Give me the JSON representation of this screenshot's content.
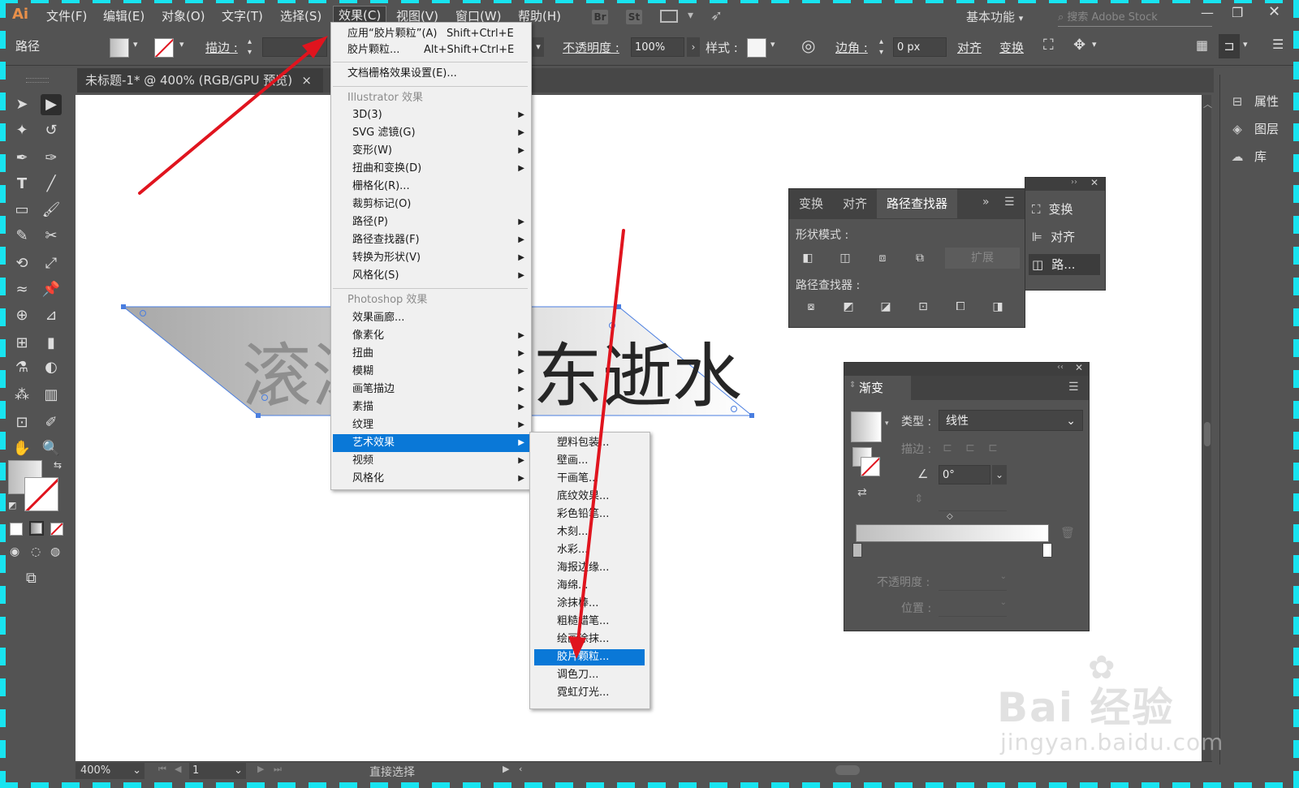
{
  "menubar": {
    "logo": "Ai",
    "items": [
      "文件(F)",
      "编辑(E)",
      "对象(O)",
      "文字(T)",
      "选择(S)",
      "效果(C)",
      "视图(V)",
      "窗口(W)",
      "帮助(H)"
    ],
    "badges": [
      "Br",
      "St"
    ],
    "workspace": "基本功能",
    "search_placeholder": "搜索 Adobe Stock"
  },
  "control_bar": {
    "selection_label": "路径",
    "stroke_label": "描边 :",
    "opacity_label": "不透明度 :",
    "opacity_value": "100%",
    "style_label": "样式 :",
    "corner_label": "边角 :",
    "corner_value": "0 px",
    "align_label": "对齐",
    "transform_label": "变换"
  },
  "document": {
    "tab_title": "未标题-1* @ 400% (RGB/GPU 预览)",
    "tab_close": "×",
    "canvas_text_left": "滚滚",
    "canvas_text_right": "东逝水"
  },
  "effect_menu": {
    "apply_last": "应用“胶片颗粒”(A)",
    "apply_last_shortcut": "Shift+Ctrl+E",
    "last_effect": "胶片颗粒...",
    "last_effect_shortcut": "Alt+Shift+Ctrl+E",
    "doc_raster_settings": "文档栅格效果设置(E)...",
    "illustrator_header": "Illustrator 效果",
    "illustrator_items": [
      "3D(3)",
      "SVG 滤镜(G)",
      "变形(W)",
      "扭曲和变换(D)",
      "栅格化(R)...",
      "裁剪标记(O)",
      "路径(P)",
      "路径查找器(F)",
      "转换为形状(V)",
      "风格化(S)"
    ],
    "photoshop_header": "Photoshop 效果",
    "photoshop_items": [
      "效果画廊...",
      "像素化",
      "扭曲",
      "模糊",
      "画笔描边",
      "素描",
      "纹理",
      "艺术效果",
      "视频",
      "风格化"
    ]
  },
  "art_submenu": {
    "items": [
      "塑料包装...",
      "壁画...",
      "干画笔...",
      "底纹效果...",
      "彩色铅笔...",
      "木刻...",
      "水彩...",
      "海报边缘...",
      "海绵...",
      "涂抹棒...",
      "粗糙蜡笔...",
      "绘画涂抹...",
      "胶片颗粒...",
      "调色刀...",
      "霓虹灯光..."
    ],
    "highlighted": "胶片颗粒..."
  },
  "pathfinder_panel": {
    "tabs": [
      "变换",
      "对齐",
      "路径查找器"
    ],
    "shape_modes_label": "形状模式 :",
    "expand_label": "扩展",
    "pathfinders_label": "路径查找器 :"
  },
  "mini_panel": {
    "items": [
      "变换",
      "对齐",
      "路..."
    ]
  },
  "gradient_panel": {
    "title": "渐变",
    "type_label": "类型 :",
    "type_value": "线性",
    "stroke_label": "描边 :",
    "angle_value": "0°",
    "opacity_label": "不透明度 :",
    "position_label": "位置 :"
  },
  "right_panel": {
    "items": [
      "属性",
      "图层",
      "库"
    ]
  },
  "status_bar": {
    "zoom": "400%",
    "artboard": "1",
    "tool_name": "直接选择"
  },
  "watermark": {
    "brand": "Bai  经验",
    "url": "jingyan.baidu.com"
  },
  "colors": {
    "ui_gray": "#535353",
    "highlight_blue": "#0a78d7",
    "arrow_red": "#e0141e",
    "dash_cyan": "#18e4f0"
  }
}
